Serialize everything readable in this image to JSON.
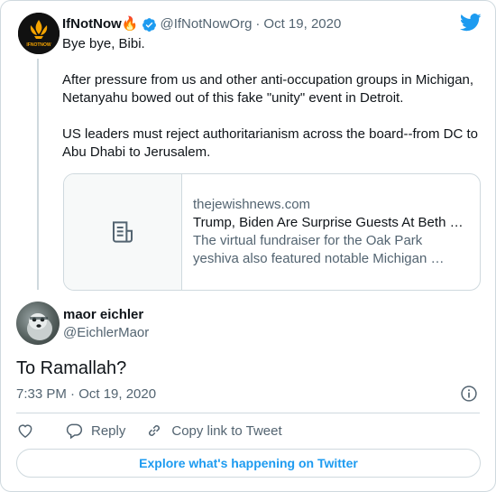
{
  "parent_tweet": {
    "avatar_text": "IFNOTNOW",
    "display_name": "IfNotNow🔥",
    "handle": "@IfNotNowOrg",
    "separator": "·",
    "date": "Oct 19, 2020",
    "text_lines": [
      "Bye bye, Bibi.",
      "After pressure from us and other anti-occupation groups in Michigan, Netanyahu bowed out of this fake \"unity\" event in Detroit.",
      "US leaders must reject authoritarianism across the board--from DC to Abu Dhabi to Jerusalem."
    ],
    "link_card": {
      "domain": "thejewishnews.com",
      "title": "Trump, Biden Are Surprise Guests At Beth …",
      "description": "The virtual fundraiser for the Oak Park yeshiva also featured notable Michigan …",
      "thumb_icon": "document-icon"
    }
  },
  "main_tweet": {
    "display_name": "maor eichler",
    "handle": "@EichlerMaor",
    "text": "To Ramallah?",
    "timestamp": "7:33 PM · Oct 19, 2020"
  },
  "actions": {
    "reply_label": "Reply",
    "copy_link_label": "Copy link to Tweet"
  },
  "explore_label": "Explore what's happening on Twitter",
  "colors": {
    "accent": "#1d9bf0",
    "text_primary": "#0f1419",
    "text_secondary": "#536471",
    "border": "#cfd9de",
    "fire": "#f4900c"
  }
}
